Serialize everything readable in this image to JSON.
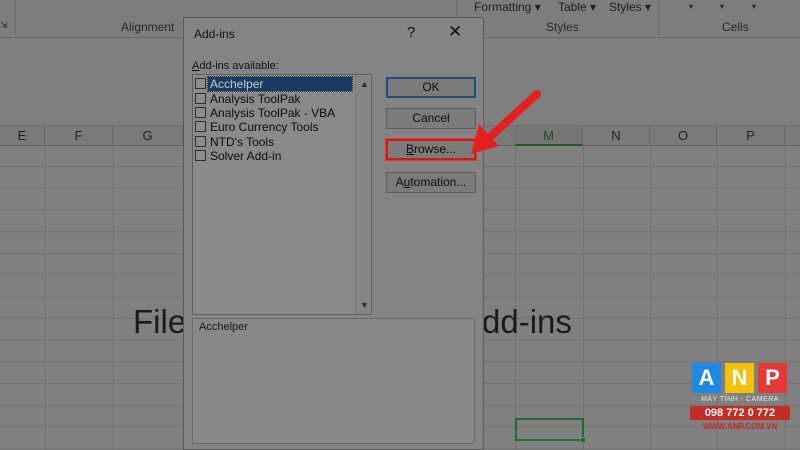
{
  "ribbon": {
    "formatting_label": "Formatting",
    "table_label": "Table",
    "styles_btn_label": "Styles",
    "alignment_group": "Alignment",
    "styles_group": "Styles",
    "cells_group": "Cells"
  },
  "columns": [
    "E",
    "F",
    "G",
    "",
    "",
    "",
    "",
    "",
    "M",
    "N",
    "O",
    "P"
  ],
  "active_column": "M",
  "caption": {
    "left": "File",
    "right": "dd-ins"
  },
  "dialog": {
    "title": "Add-ins",
    "help": "?",
    "close": "✕",
    "available_label": "Add-ins available:",
    "items": [
      {
        "label": "Acchelper",
        "checked": false,
        "selected": true
      },
      {
        "label": "Analysis ToolPak",
        "checked": false,
        "selected": false
      },
      {
        "label": "Analysis ToolPak - VBA",
        "checked": false,
        "selected": false
      },
      {
        "label": "Euro Currency Tools",
        "checked": false,
        "selected": false
      },
      {
        "label": "NTD's Tools",
        "checked": false,
        "selected": false
      },
      {
        "label": "Solver Add-in",
        "checked": false,
        "selected": false
      }
    ],
    "buttons": {
      "ok": "OK",
      "cancel": "Cancel",
      "browse": "Browse...",
      "automation": "Automation..."
    },
    "description": "Acchelper"
  },
  "logo": {
    "letters": [
      "A",
      "N",
      "P"
    ],
    "subtitle": "MÁY TÍNH - CAMERA",
    "phone": "098 772 0 772",
    "website": "WWW.ANP.COM.VN",
    "colors": [
      "#1e88e5",
      "#f4c20d",
      "#e53935"
    ]
  },
  "colors": {
    "highlight_red": "#e41f1f",
    "selection_blue": "#183a63",
    "excel_green": "#1f6b31"
  }
}
